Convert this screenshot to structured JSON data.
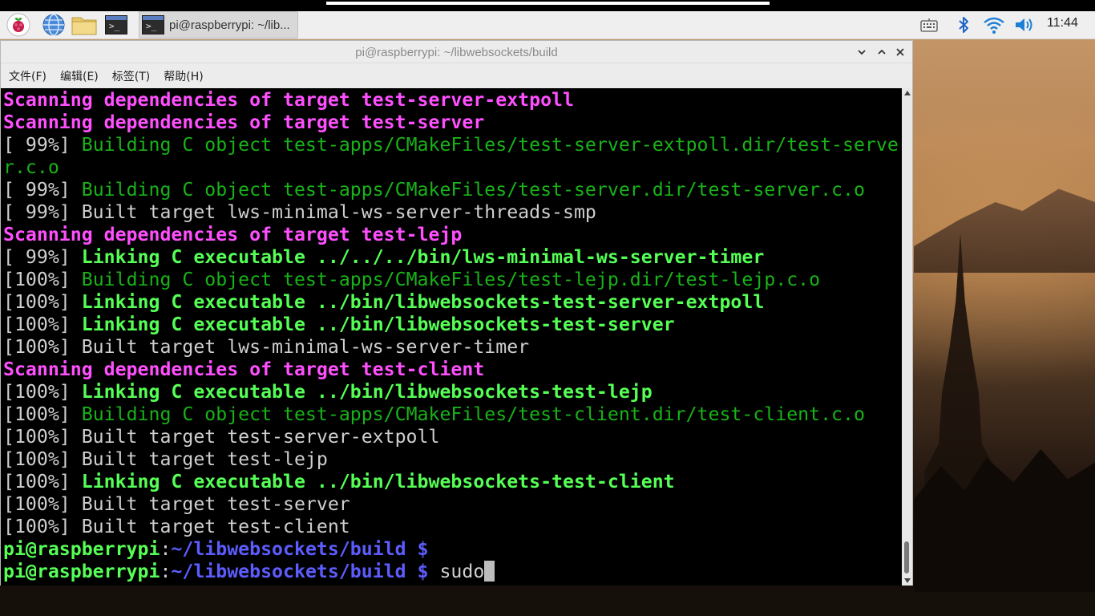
{
  "taskbar": {
    "raspberry_menu_icon": "raspberry-pi-icon",
    "browser_icon": "globe-icon",
    "files_icon": "folder-icon",
    "terminal_launcher_icon": "terminal-icon",
    "task_label": "pi@raspberrypi: ~/lib...",
    "tray_icons": [
      "keyboard-icon",
      "bluetooth-icon",
      "wifi-icon",
      "volume-icon"
    ],
    "clock": "11:44"
  },
  "window": {
    "title": "pi@raspberrypi: ~/libwebsockets/build",
    "controls": [
      "minimize-icon",
      "maximize-icon",
      "close-icon"
    ],
    "menu": [
      "文件(F)",
      "编辑(E)",
      "标签(T)",
      "帮助(H)"
    ]
  },
  "terminal": {
    "lines": [
      [
        {
          "t": "Scanning dependencies of target test-server-extpoll",
          "c": "magenta"
        }
      ],
      [
        {
          "t": "Scanning dependencies of target test-server",
          "c": "magenta"
        }
      ],
      [
        {
          "t": "[ 99%] ",
          "c": "white"
        },
        {
          "t": "Building C object test-apps/CMakeFiles/test-server-extpoll.dir/test-serve",
          "c": "green"
        }
      ],
      [
        {
          "t": "r.c.o",
          "c": "green"
        }
      ],
      [
        {
          "t": "[ 99%] ",
          "c": "white"
        },
        {
          "t": "Building C object test-apps/CMakeFiles/test-server.dir/test-server.c.o",
          "c": "green"
        }
      ],
      [
        {
          "t": "[ 99%] Built target lws-minimal-ws-server-threads-smp",
          "c": "white"
        }
      ],
      [
        {
          "t": "Scanning dependencies of target test-lejp",
          "c": "magenta"
        }
      ],
      [
        {
          "t": "[ 99%] ",
          "c": "white"
        },
        {
          "t": "Linking C executable ../../../bin/lws-minimal-ws-server-timer",
          "c": "bgreen"
        }
      ],
      [
        {
          "t": "[100%] ",
          "c": "white"
        },
        {
          "t": "Building C object test-apps/CMakeFiles/test-lejp.dir/test-lejp.c.o",
          "c": "green"
        }
      ],
      [
        {
          "t": "[100%] ",
          "c": "white"
        },
        {
          "t": "Linking C executable ../bin/libwebsockets-test-server-extpoll",
          "c": "bgreen"
        }
      ],
      [
        {
          "t": "[100%] ",
          "c": "white"
        },
        {
          "t": "Linking C executable ../bin/libwebsockets-test-server",
          "c": "bgreen"
        }
      ],
      [
        {
          "t": "[100%] Built target lws-minimal-ws-server-timer",
          "c": "white"
        }
      ],
      [
        {
          "t": "Scanning dependencies of target test-client",
          "c": "magenta"
        }
      ],
      [
        {
          "t": "[100%] ",
          "c": "white"
        },
        {
          "t": "Linking C executable ../bin/libwebsockets-test-lejp",
          "c": "bgreen"
        }
      ],
      [
        {
          "t": "[100%] ",
          "c": "white"
        },
        {
          "t": "Building C object test-apps/CMakeFiles/test-client.dir/test-client.c.o",
          "c": "green"
        }
      ],
      [
        {
          "t": "[100%] Built target test-server-extpoll",
          "c": "white"
        }
      ],
      [
        {
          "t": "[100%] Built target test-lejp",
          "c": "white"
        }
      ],
      [
        {
          "t": "[100%] ",
          "c": "white"
        },
        {
          "t": "Linking C executable ../bin/libwebsockets-test-client",
          "c": "bgreen"
        }
      ],
      [
        {
          "t": "[100%] Built target test-server",
          "c": "white"
        }
      ],
      [
        {
          "t": "[100%] Built target test-client",
          "c": "white"
        }
      ],
      [
        {
          "t": "pi@raspberrypi",
          "c": "bgreen"
        },
        {
          "t": ":",
          "c": "white"
        },
        {
          "t": "~/libwebsockets/build $",
          "c": "blue"
        }
      ],
      [
        {
          "t": "pi@raspberrypi",
          "c": "bgreen"
        },
        {
          "t": ":",
          "c": "white"
        },
        {
          "t": "~/libwebsockets/build $",
          "c": "blue"
        },
        {
          "t": " sudo",
          "c": "white"
        }
      ]
    ],
    "colors": {
      "magenta": "#ff4fff",
      "green": "#18b218",
      "bgreen": "#55ff55",
      "blue": "#5c5cff",
      "white": "#cfcfcf"
    }
  }
}
